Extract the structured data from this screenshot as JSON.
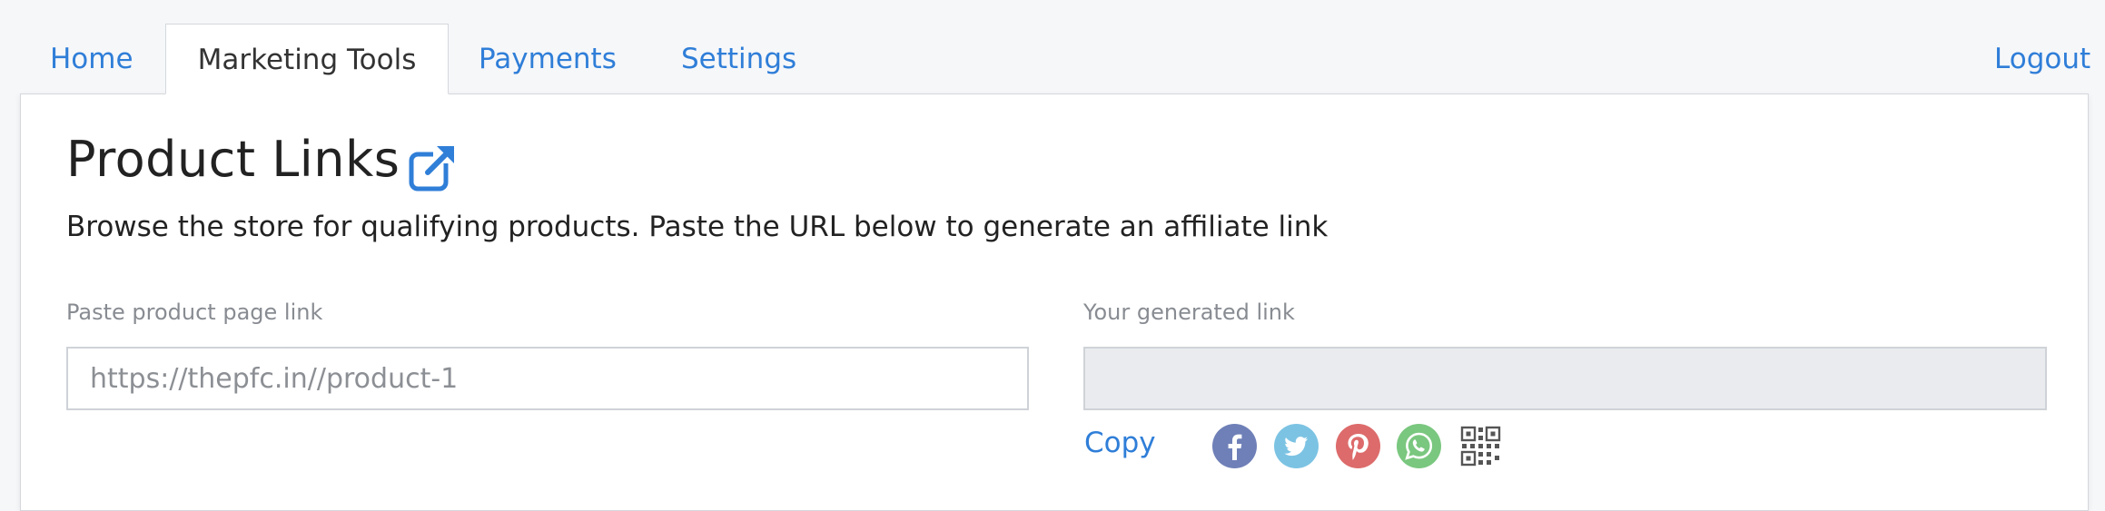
{
  "nav": {
    "tabs": [
      {
        "label": "Home"
      },
      {
        "label": "Marketing Tools",
        "active": true
      },
      {
        "label": "Payments"
      },
      {
        "label": "Settings"
      }
    ],
    "logout_label": "Logout"
  },
  "page": {
    "title": "Product Links",
    "title_icon": "external-link-icon",
    "subtitle": "Browse the store for qualifying products. Paste the URL below to generate an affiliate link"
  },
  "product_link": {
    "label": "Paste product page link",
    "placeholder": "https://thepfc.in//product-1",
    "value": ""
  },
  "generated_link": {
    "label": "Your generated link",
    "value": ""
  },
  "actions": {
    "copy_label": "Copy",
    "share_icons": [
      "facebook-icon",
      "twitter-icon",
      "pinterest-icon",
      "whatsapp-icon",
      "qr-code-icon"
    ]
  },
  "colors": {
    "accent": "#2f7ed8",
    "facebook": "#6f80b8",
    "twitter": "#7cc3e3",
    "pinterest": "#dd6b6b",
    "whatsapp": "#7ac77f",
    "qr": "#555555",
    "generated_bg": "#e9ebee"
  }
}
